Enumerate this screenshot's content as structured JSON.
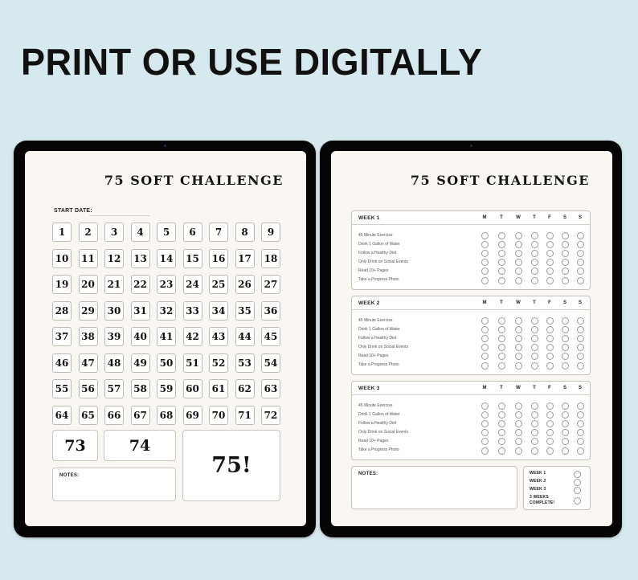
{
  "headline": "PRINT OR USE DIGITALLY",
  "left_page": {
    "title": "75 SOFT CHALLENGE",
    "start_date_label": "START DATE:",
    "days": [
      "1",
      "2",
      "3",
      "4",
      "5",
      "6",
      "7",
      "8",
      "9",
      "10",
      "11",
      "12",
      "13",
      "14",
      "15",
      "16",
      "17",
      "18",
      "19",
      "20",
      "21",
      "22",
      "23",
      "24",
      "25",
      "26",
      "27",
      "28",
      "29",
      "30",
      "31",
      "32",
      "33",
      "34",
      "35",
      "36",
      "37",
      "38",
      "39",
      "40",
      "41",
      "42",
      "43",
      "44",
      "45",
      "46",
      "47",
      "48",
      "49",
      "50",
      "51",
      "52",
      "53",
      "54",
      "55",
      "56",
      "57",
      "58",
      "59",
      "60",
      "61",
      "62",
      "63",
      "64",
      "65",
      "66",
      "67",
      "68",
      "69",
      "70",
      "71",
      "72"
    ],
    "day_73": "73",
    "day_74": "74",
    "day_75": "75!",
    "notes_label": "NOTES:"
  },
  "right_page": {
    "title": "75 SOFT CHALLENGE",
    "days_of_week": [
      "M",
      "T",
      "W",
      "T",
      "F",
      "S",
      "S"
    ],
    "tasks": [
      "45 Minute Exercise",
      "Drink 1 Gallon of Water",
      "Follow a Healthy Diet",
      "Only Drink on Social Events",
      "Read 10+ Pages",
      "Take a Progress Photo"
    ],
    "weeks": [
      {
        "label": "WEEK 1"
      },
      {
        "label": "WEEK 2"
      },
      {
        "label": "WEEK 3"
      }
    ],
    "notes_label": "NOTES:",
    "summary": [
      "WEEK 1",
      "WEEK 2",
      "WEEK 3",
      "3 WEEKS COMPLETE!"
    ]
  }
}
